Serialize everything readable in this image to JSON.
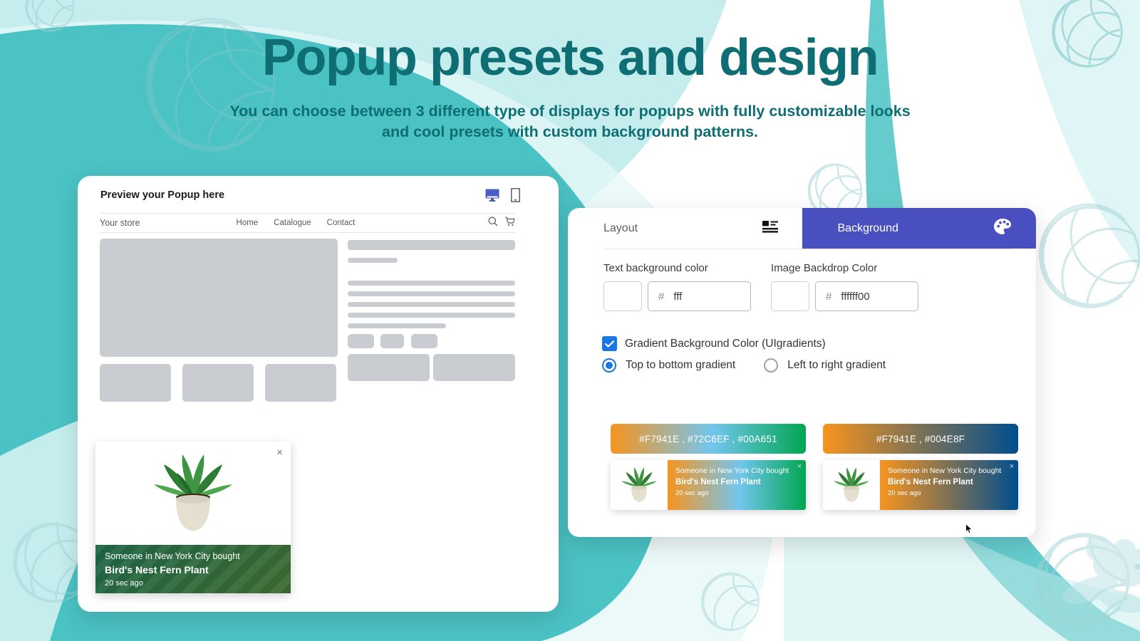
{
  "hero": {
    "title": "Popup presets and design",
    "subtitle": "You can choose between 3 different type of displays for popups with fully customizable looks and cool presets with custom background patterns.",
    "title_color": "#0E6E73"
  },
  "preview": {
    "heading": "Preview your Popup here",
    "devices": [
      {
        "name": "desktop-preview-toggle",
        "icon": "monitor-icon",
        "active": true
      },
      {
        "name": "mobile-preview-toggle",
        "icon": "mobile-icon",
        "active": false
      }
    ],
    "store": {
      "name": "Your store",
      "nav": [
        "Home",
        "Catalogue",
        "Contact"
      ],
      "tools": [
        "search-icon",
        "cart-icon"
      ]
    }
  },
  "popups": [
    {
      "id": "vertical-green",
      "line1": "Someone in New York City bought",
      "line2": "Bird's Nest Fern Plant",
      "line3": "20 sec ago",
      "close": "×",
      "style": "vertical",
      "color": "#1e6647"
    },
    {
      "id": "horizontal-maroon",
      "line1": "Someone in New York City bought",
      "line2": "Bird's Nest Fern Plant",
      "line3": "20 sec ago",
      "close": "×",
      "style": "horizontal-circle",
      "color": "#8d4456"
    },
    {
      "id": "horizontal-olive",
      "line1": "Someone in New York City bought",
      "line2": "Bird's Nest Fern Plant",
      "line3": "20 sec ago",
      "close": "×",
      "style": "horizontal-square",
      "color": "#5a6130"
    }
  ],
  "settings": {
    "tabs": [
      {
        "label": "Layout",
        "icon": "layout-icon",
        "active": false
      },
      {
        "label": "Background",
        "icon": "palette-icon",
        "active": true
      }
    ],
    "active_tab_color": "#4A4FBF",
    "fields": [
      {
        "label": "Text background color",
        "hash": "#",
        "value": "fff",
        "swatch": "#ffffff"
      },
      {
        "label": "Image Backdrop Color",
        "hash": "#",
        "value": "ffffff00",
        "swatch": "#ffffff"
      }
    ],
    "checkbox": {
      "label": "Gradient Background Color (UIgradients)",
      "checked": true,
      "color": "#1877E3"
    },
    "radios": [
      {
        "label": "Top to bottom gradient",
        "selected": true
      },
      {
        "label": "Left to right gradient",
        "selected": false
      }
    ],
    "presets": [
      {
        "label": "#F7941E , #72C6EF , #00A651",
        "colors": [
          "#F7941E",
          "#72C6EF",
          "#00A651"
        ],
        "card": {
          "line1": "Someone in New York City bought",
          "line2": "Bird's Nest Fern Plant",
          "line3": "20 sec ago",
          "close": "×"
        }
      },
      {
        "label": "#F7941E , #004E8F",
        "colors": [
          "#F7941E",
          "#004E8F"
        ],
        "card": {
          "line1": "Someone in New York City bought",
          "line2": "Bird's Nest Fern Plant",
          "line3": "20 sec ago",
          "close": "×"
        }
      }
    ]
  },
  "background": {
    "teal_dark": "#4BC2C4",
    "teal_light": "#C6EDEE",
    "teal_pale": "#E6F7F7",
    "motif": "yarn-ball"
  }
}
